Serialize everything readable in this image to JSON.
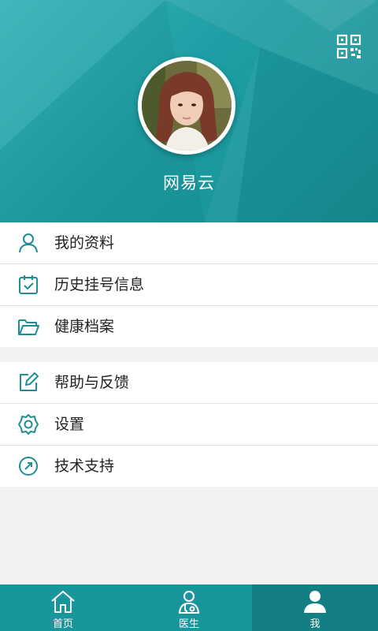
{
  "profile": {
    "username": "网易云",
    "qr_icon": "qr-code-icon",
    "avatar": "user-avatar"
  },
  "menu": {
    "group1": [
      {
        "label": "我的资料",
        "icon": "person-icon"
      },
      {
        "label": "历史挂号信息",
        "icon": "calendar-check-icon"
      },
      {
        "label": "健康档案",
        "icon": "folder-icon"
      }
    ],
    "group2": [
      {
        "label": "帮助与反馈",
        "icon": "edit-icon"
      },
      {
        "label": "设置",
        "icon": "gear-icon"
      },
      {
        "label": "技术支持",
        "icon": "compass-icon"
      }
    ]
  },
  "tabbar": {
    "tabs": [
      {
        "label": "首页",
        "icon": "home-icon"
      },
      {
        "label": "医生",
        "icon": "doctor-icon"
      },
      {
        "label": "我",
        "icon": "user-icon"
      }
    ],
    "active": "我"
  },
  "colors": {
    "brand": "#1e9ea4",
    "tab_active": "#137f84"
  }
}
